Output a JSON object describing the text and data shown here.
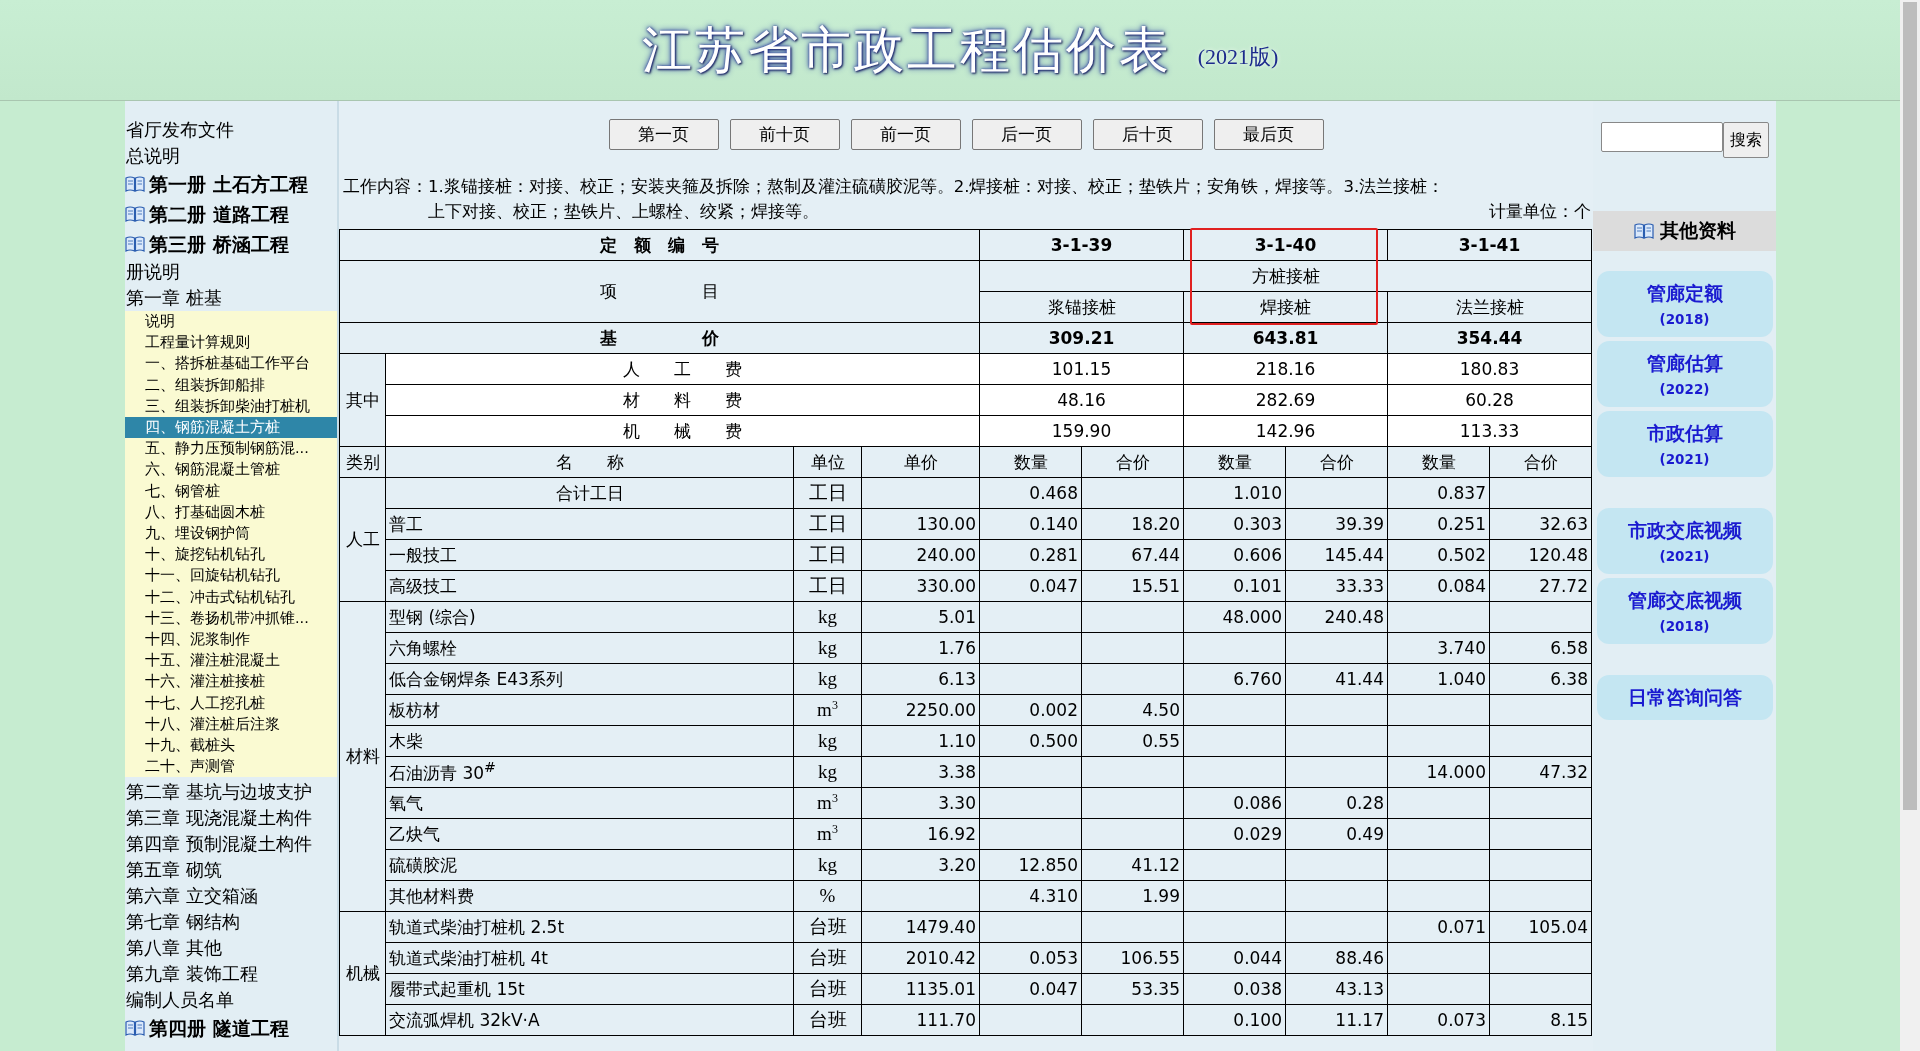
{
  "header": {
    "title": "江苏省市政工程估价表",
    "edition": "(2021版)"
  },
  "nav": [
    {
      "kind": "link",
      "label": "省厅发布文件"
    },
    {
      "kind": "link",
      "label": "总说明"
    },
    {
      "kind": "volume",
      "label": "第一册 土石方工程"
    },
    {
      "kind": "volume",
      "label": "第二册 道路工程"
    },
    {
      "kind": "volume",
      "label": "第三册 桥涵工程",
      "children": [
        {
          "kind": "link",
          "label": "册说明"
        },
        {
          "kind": "chapter",
          "label": "第一章 桩基",
          "children": [
            {
              "kind": "section",
              "label": "说明",
              "selected": false
            },
            {
              "kind": "section",
              "label": "工程量计算规则",
              "selected": false
            },
            {
              "kind": "section",
              "label": "一、搭拆桩基础工作平台",
              "selected": false
            },
            {
              "kind": "section",
              "label": "二、组装拆卸船排",
              "selected": false
            },
            {
              "kind": "section",
              "label": "三、组装拆卸柴油打桩机",
              "selected": false
            },
            {
              "kind": "section",
              "label": "四、钢筋混凝土方桩",
              "selected": true
            },
            {
              "kind": "section",
              "label": "五、静力压预制钢筋混...",
              "selected": false
            },
            {
              "kind": "section",
              "label": "六、钢筋混凝土管桩",
              "selected": false
            },
            {
              "kind": "section",
              "label": "七、钢管桩",
              "selected": false
            },
            {
              "kind": "section",
              "label": "八、打基础圆木桩",
              "selected": false
            },
            {
              "kind": "section",
              "label": "九、埋设钢护筒",
              "selected": false
            },
            {
              "kind": "section",
              "label": "十、旋挖钻机钻孔",
              "selected": false
            },
            {
              "kind": "section",
              "label": "十一、回旋钻机钻孔",
              "selected": false
            },
            {
              "kind": "section",
              "label": "十二、冲击式钻机钻孔",
              "selected": false
            },
            {
              "kind": "section",
              "label": "十三、卷扬机带冲抓锥...",
              "selected": false
            },
            {
              "kind": "section",
              "label": "十四、泥浆制作",
              "selected": false
            },
            {
              "kind": "section",
              "label": "十五、灌注桩混凝土",
              "selected": false
            },
            {
              "kind": "section",
              "label": "十六、灌注桩接桩",
              "selected": false
            },
            {
              "kind": "section",
              "label": "十七、人工挖孔桩",
              "selected": false
            },
            {
              "kind": "section",
              "label": "十八、灌注桩后注浆",
              "selected": false
            },
            {
              "kind": "section",
              "label": "十九、截桩头",
              "selected": false
            },
            {
              "kind": "section",
              "label": "二十、声测管",
              "selected": false
            }
          ]
        },
        {
          "kind": "chapter",
          "label": "第二章 基坑与边坡支护"
        },
        {
          "kind": "chapter",
          "label": "第三章 现浇混凝土构件"
        },
        {
          "kind": "chapter",
          "label": "第四章 预制混凝土构件"
        },
        {
          "kind": "chapter",
          "label": "第五章 砌筑"
        },
        {
          "kind": "chapter",
          "label": "第六章 立交箱涵"
        },
        {
          "kind": "chapter",
          "label": "第七章 钢结构"
        },
        {
          "kind": "chapter",
          "label": "第八章 其他"
        },
        {
          "kind": "chapter",
          "label": "第九章 装饰工程"
        },
        {
          "kind": "link",
          "label": "编制人员名单"
        }
      ]
    },
    {
      "kind": "volume",
      "label": "第四册 隧道工程"
    }
  ],
  "pager": [
    "第一页",
    "前十页",
    "前一页",
    "后一页",
    "后十页",
    "最后页"
  ],
  "work_content": {
    "label": "工作内容：",
    "text": "1.浆锚接桩：对接、校正；安装夹箍及拆除；熬制及灌注硫磺胶泥等。2.焊接桩：对接、校正；垫铁片；安角铁，焊接等。3.法兰接桩：上下对接、校正；垫铁片、上螺栓、绞紧；焊接等。",
    "unit": "计量单位：个"
  },
  "quota": {
    "code_label": "定　额　编　号",
    "item_label": "项　　　　　目",
    "group_label": "方桩接桩",
    "base_label": "基　　　　　价",
    "breakdown_label": "其中",
    "columns": [
      {
        "code": "3-1-39",
        "name": "浆锚接桩",
        "base_price": "309.21",
        "highlighted": false
      },
      {
        "code": "3-1-40",
        "name": "焊接桩",
        "base_price": "643.81",
        "highlighted": true
      },
      {
        "code": "3-1-41",
        "name": "法兰接桩",
        "base_price": "354.44",
        "highlighted": false
      }
    ],
    "breakdown": [
      {
        "label": "人　　工　　费",
        "values": [
          "101.15",
          "218.16",
          "180.83"
        ]
      },
      {
        "label": "材　　料　　费",
        "values": [
          "48.16",
          "282.69",
          "60.28"
        ]
      },
      {
        "label": "机　　械　　费",
        "values": [
          "159.90",
          "142.96",
          "113.33"
        ]
      }
    ]
  },
  "resources": {
    "headers": {
      "category": "类别",
      "name": "名　　称",
      "unit": "单位",
      "price": "单价",
      "columns": [
        {
          "quantity": "数量",
          "total": "合价"
        },
        {
          "quantity": "数量",
          "total": "合价"
        },
        {
          "quantity": "数量",
          "total": "合价"
        }
      ]
    },
    "groups": [
      {
        "category": "人工",
        "rows": [
          {
            "kind": "total",
            "name": "合计工日",
            "unit": "工日",
            "values": {
              "quota_1": {
                "quantity": "0.468"
              },
              "quota_2": {
                "quantity": "1.010"
              },
              "quota_3": {
                "quantity": "0.837"
              }
            }
          },
          {
            "kind": "item",
            "name": "普工",
            "unit": "工日",
            "price": "130.00",
            "values": {
              "quota_1": {
                "quantity": "0.140",
                "total": "18.20"
              },
              "quota_2": {
                "quantity": "0.303",
                "total": "39.39"
              },
              "quota_3": {
                "quantity": "0.251",
                "total": "32.63"
              }
            }
          },
          {
            "kind": "item",
            "name": "一般技工",
            "unit": "工日",
            "price": "240.00",
            "values": {
              "quota_1": {
                "quantity": "0.281",
                "total": "67.44"
              },
              "quota_2": {
                "quantity": "0.606",
                "total": "145.44"
              },
              "quota_3": {
                "quantity": "0.502",
                "total": "120.48"
              }
            }
          },
          {
            "kind": "item",
            "name": "高级技工",
            "unit": "工日",
            "price": "330.00",
            "values": {
              "quota_1": {
                "quantity": "0.047",
                "total": "15.51"
              },
              "quota_2": {
                "quantity": "0.101",
                "total": "33.33"
              },
              "quota_3": {
                "quantity": "0.084",
                "total": "27.72"
              }
            }
          }
        ]
      },
      {
        "category": "材料",
        "rows": [
          {
            "kind": "item",
            "name": "型钢 (综合)",
            "unit": "kg",
            "price": "5.01",
            "values": {
              "quota_2": {
                "quantity": "48.000",
                "total": "240.48"
              }
            }
          },
          {
            "kind": "item",
            "name": "六角螺栓",
            "unit": "kg",
            "price": "1.76",
            "values": {
              "quota_3": {
                "quantity": "3.740",
                "total": "6.58"
              }
            }
          },
          {
            "kind": "item",
            "name": "低合金钢焊条 E43系列",
            "unit": "kg",
            "price": "6.13",
            "values": {
              "quota_2": {
                "quantity": "6.760",
                "total": "41.44"
              },
              "quota_3": {
                "quantity": "1.040",
                "total": "6.38"
              }
            }
          },
          {
            "kind": "item",
            "name": "板枋材",
            "unit": "m$^{3}$",
            "price": "2250.00",
            "values": {
              "quota_1": {
                "quantity": "0.002",
                "total": "4.50"
              }
            }
          },
          {
            "kind": "item",
            "name": "木柴",
            "unit": "kg",
            "price": "1.10",
            "values": {
              "quota_1": {
                "quantity": "0.500",
                "total": "0.55"
              }
            }
          },
          {
            "kind": "item",
            "name": "石油沥青 30$^{#}$",
            "unit": "kg",
            "price": "3.38",
            "values": {
              "quota_3": {
                "quantity": "14.000",
                "total": "47.32"
              }
            }
          },
          {
            "kind": "item",
            "name": "氧气",
            "unit": "m$^{3}$",
            "price": "3.30",
            "values": {
              "quota_2": {
                "quantity": "0.086",
                "total": "0.28"
              }
            }
          },
          {
            "kind": "item",
            "name": "乙炔气",
            "unit": "m$^{3}$",
            "price": "16.92",
            "values": {
              "quota_2": {
                "quantity": "0.029",
                "total": "0.49"
              }
            }
          },
          {
            "kind": "item",
            "name": "硫磺胶泥",
            "unit": "kg",
            "price": "3.20",
            "values": {
              "quota_1": {
                "quantity": "12.850",
                "total": "41.12"
              }
            }
          },
          {
            "kind": "item",
            "name": "其他材料费",
            "unit": "%",
            "values": {
              "quota_1": {
                "quantity": "4.310",
                "total": "1.99"
              }
            }
          }
        ]
      },
      {
        "category": "机械",
        "rows": [
          {
            "kind": "item",
            "name": "轨道式柴油打桩机 2.5t",
            "unit": "台班",
            "price": "1479.40",
            "values": {
              "quota_3": {
                "quantity": "0.071",
                "total": "105.04"
              }
            }
          },
          {
            "kind": "item",
            "name": "轨道式柴油打桩机 4t",
            "unit": "台班",
            "price": "2010.42",
            "values": {
              "quota_1": {
                "quantity": "0.053",
                "total": "106.55"
              },
              "quota_2": {
                "quantity": "0.044",
                "total": "88.46"
              }
            }
          },
          {
            "kind": "item",
            "name": "履带式起重机 15t",
            "unit": "台班",
            "price": "1135.01",
            "values": {
              "quota_1": {
                "quantity": "0.047",
                "total": "53.35"
              },
              "quota_2": {
                "quantity": "0.038",
                "total": "43.13"
              }
            }
          },
          {
            "kind": "item",
            "name": "交流弧焊机 32kV·A",
            "unit": "台班",
            "price": "111.70",
            "values": {
              "quota_2": {
                "quantity": "0.100",
                "total": "11.17"
              },
              "quota_3": {
                "quantity": "0.073",
                "total": "8.15"
              }
            }
          }
        ]
      }
    ]
  },
  "sidebar": {
    "search": {
      "button": "搜索"
    },
    "heading": "其他资料",
    "link_groups": [
      [
        {
          "title": "管廊定额",
          "year": "(2018)"
        },
        {
          "title": "管廊估算",
          "year": "(2022)"
        },
        {
          "title": "市政估算",
          "year": "(2021)"
        }
      ],
      [
        {
          "title": "市政交底视频",
          "year": "(2021)"
        },
        {
          "title": "管廊交底视频",
          "year": "(2018)"
        }
      ],
      [
        {
          "title": "日常咨询问答"
        }
      ]
    ]
  }
}
